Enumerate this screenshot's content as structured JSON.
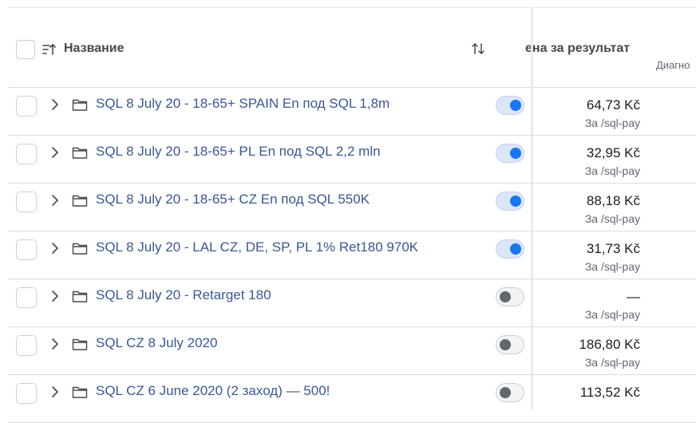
{
  "header": {
    "name_label": "Название",
    "cost_label": "ена за результат",
    "diag_label": "Диагно"
  },
  "rows": [
    {
      "name": "SQL 8 July 20 - 18-65+ SPAIN En под SQL 1,8m",
      "active": true,
      "value": "64,73 Kč",
      "sub": "За /sql-pay"
    },
    {
      "name": "SQL 8 July 20 - 18-65+ PL En под SQL 2,2 mln",
      "active": true,
      "value": "32,95 Kč",
      "sub": "За /sql-pay"
    },
    {
      "name": "SQL 8 July 20 - 18-65+ CZ En под SQL 550K",
      "active": true,
      "value": "88,18 Kč",
      "sub": "За /sql-pay"
    },
    {
      "name": "SQL 8 July 20 - LAL CZ, DE, SP, PL 1% Ret180 970K",
      "active": true,
      "value": "31,73 Kč",
      "sub": "За /sql-pay"
    },
    {
      "name": "SQL 8 July 20 - Retarget 180",
      "active": false,
      "value": "—",
      "sub": "За /sql-pay"
    },
    {
      "name": "SQL CZ 8 July 2020",
      "active": false,
      "value": "186,80 Kč",
      "sub": "За /sql-pay"
    },
    {
      "name": "SQL CZ 6 June 2020 (2 заход) — 500!",
      "active": false,
      "value": "113,52 Kč",
      "sub": ""
    }
  ],
  "icons": {
    "sort": "sort-ascending-icon",
    "updown": "sort-updown-icon",
    "chevron": "chevron-right-icon",
    "folder": "folder-icon"
  },
  "colors": {
    "link": "#385898",
    "toggle_on": "#1877f2",
    "toggle_off": "#606770"
  }
}
